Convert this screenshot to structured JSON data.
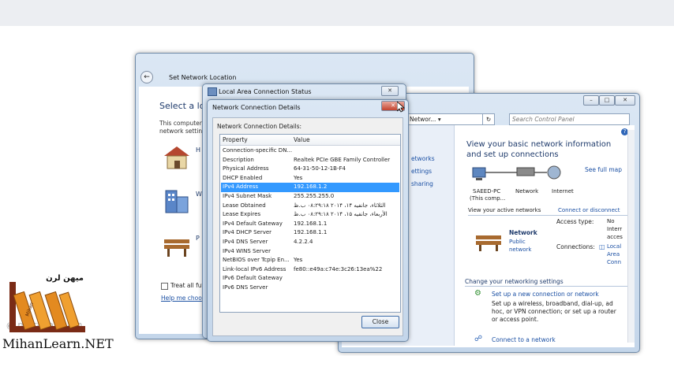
{
  "watermark": {
    "site": "MihanLearn.NET",
    "channel": "marava_learn",
    "logo_text": "میهن لرن",
    "logo_book_text": "Mihan"
  },
  "set_network_location": {
    "title": "Set Network Location",
    "heading": "Select a loca",
    "text_line1": "This computer",
    "text_line2": "network setting",
    "options": [
      {
        "label": "H",
        "icon": "home-network-icon"
      },
      {
        "label": "W",
        "icon": "work-network-icon"
      },
      {
        "label": "P",
        "icon": "public-network-icon"
      }
    ],
    "checkbox_label": "Treat all futu",
    "help_link": "Help me choo"
  },
  "control_panel": {
    "address": "Networ...",
    "search_placeholder": "Search Control Panel",
    "left_links": [
      "etworks",
      "ettings",
      "sharing"
    ],
    "main_heading": "View your basic network information and set up connections",
    "see_full_map": "See full map",
    "map_nodes": {
      "pc": "SAEED-PC",
      "pc_sub": "(This comp...",
      "network": "Network",
      "internet": "Internet"
    },
    "active_networks_label": "View your active networks",
    "connect_disconnect": "Connect or disconnect",
    "network_name": "Network",
    "network_type_line1": "Public",
    "network_type_line2": "network",
    "access_type_label": "Access type:",
    "access_type_value": [
      "No",
      "Interr",
      "acces"
    ],
    "connections_label": "Connections:",
    "connections_value": [
      "Local",
      "Area",
      "Conn"
    ],
    "change_settings_label": "Change your networking settings",
    "setup_link": "Set up a new connection or network",
    "setup_desc": [
      "Set up a wireless, broadband, dial-up, ad",
      "hoc, or VPN connection; or set up a router",
      "or access point."
    ],
    "connect_link": "Connect to a network"
  },
  "local_area_status": {
    "title": "Local Area Connection Status"
  },
  "details": {
    "title": "Network Connection Details",
    "label": "Network Connection Details:",
    "columns": [
      "Property",
      "Value"
    ],
    "rows": [
      {
        "p": "Connection-specific DN...",
        "v": ""
      },
      {
        "p": "Description",
        "v": "Realtek PCIe GBE Family Controller"
      },
      {
        "p": "Physical Address",
        "v": "64-31-50-12-1B-F4"
      },
      {
        "p": "DHCP Enabled",
        "v": "Yes"
      },
      {
        "p": "IPv4 Address",
        "v": "192.168.1.2",
        "selected": true
      },
      {
        "p": "IPv4 Subnet Mask",
        "v": "255.255.255.0"
      },
      {
        "p": "Lease Obtained",
        "v": "الثلاثاء، جانفيه ۱۴، ۲۰۱۴ ۰۸:۲۹:۱۸ ب.ظ"
      },
      {
        "p": "Lease Expires",
        "v": "الأربعاء، جانفيه ۱۵، ۲۰۱۴ ۰۸:۲۹:۱۸ ب.ظ"
      },
      {
        "p": "IPv4 Default Gateway",
        "v": "192.168.1.1"
      },
      {
        "p": "IPv4 DHCP Server",
        "v": "192.168.1.1"
      },
      {
        "p": "IPv4 DNS Server",
        "v": "4.2.2.4"
      },
      {
        "p": "IPv4 WINS Server",
        "v": ""
      },
      {
        "p": "NetBIOS over Tcpip En...",
        "v": "Yes"
      },
      {
        "p": "Link-local IPv6 Address",
        "v": "fe80::e49a:c74e:3c26:13ea%22"
      },
      {
        "p": "IPv6 Default Gateway",
        "v": ""
      },
      {
        "p": "IPv6 DNS Server",
        "v": ""
      }
    ],
    "close_label": "Close"
  }
}
